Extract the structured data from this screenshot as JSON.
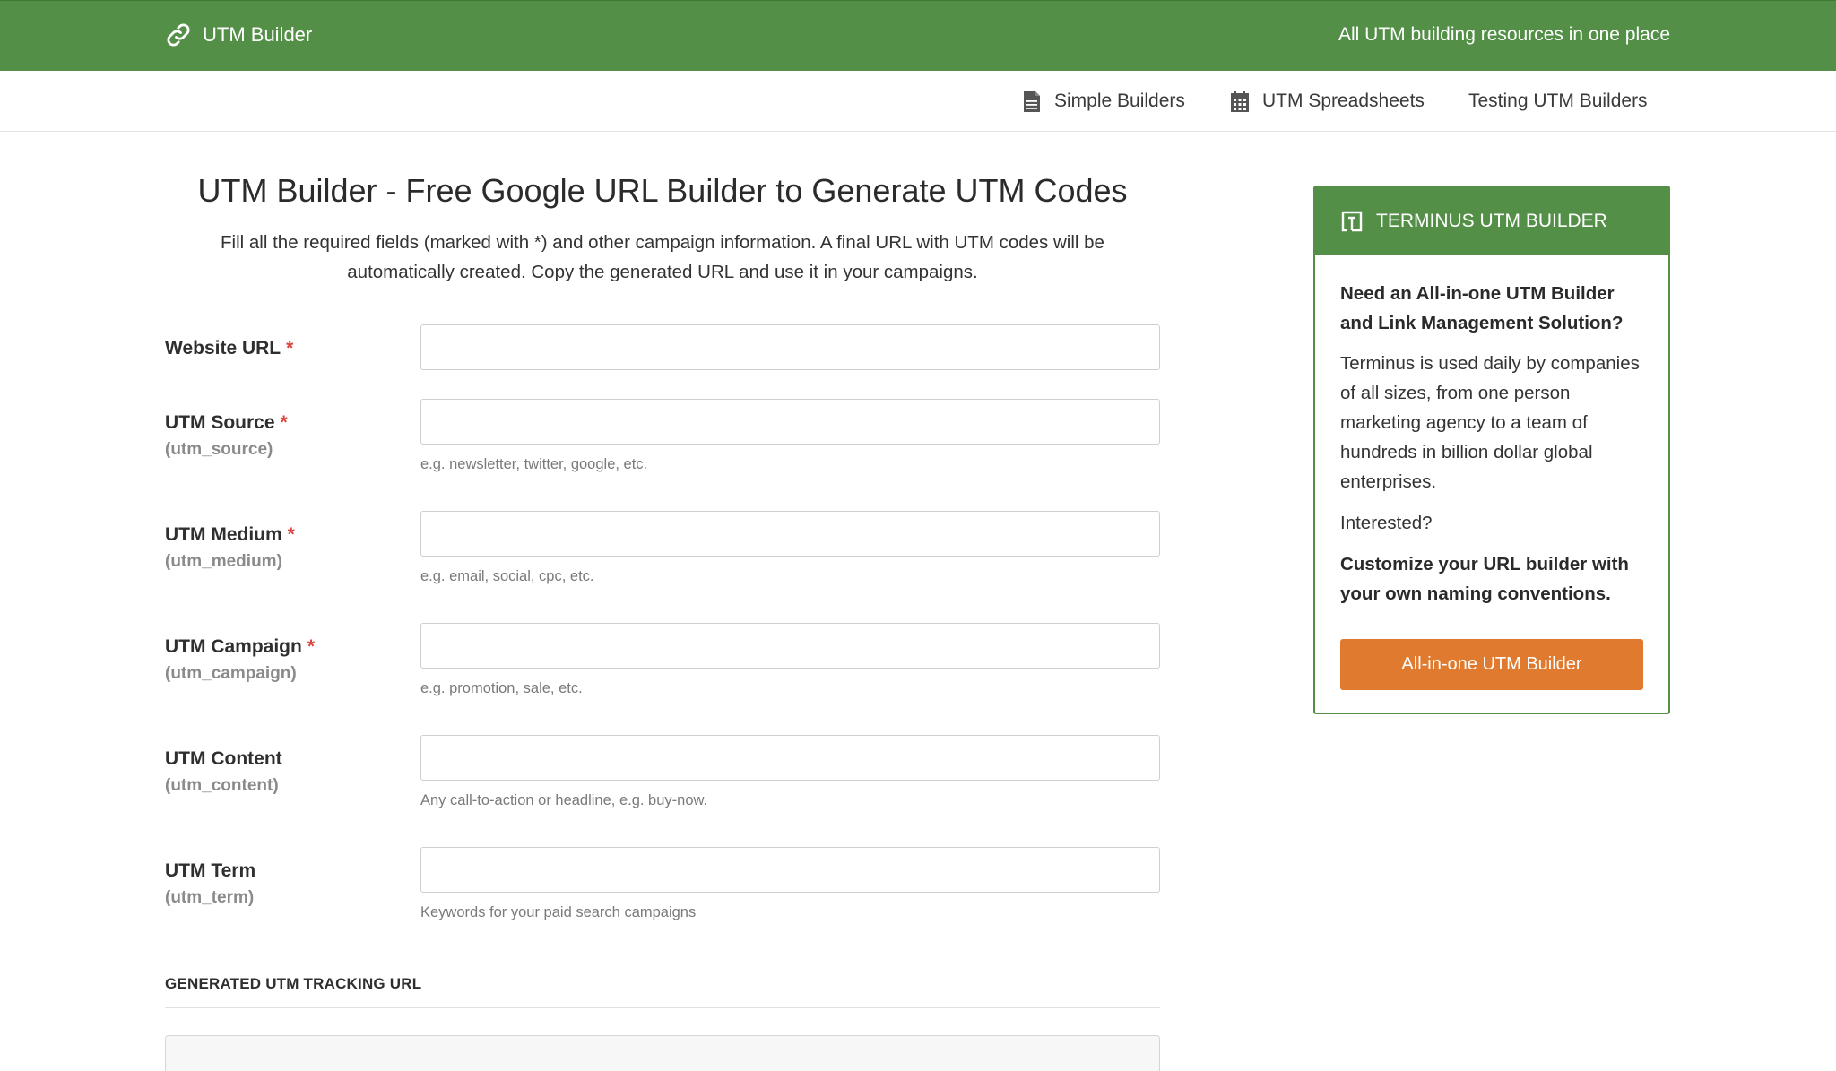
{
  "header": {
    "brand": "UTM Builder",
    "tagline": "All UTM building resources in one place",
    "brand_icon": "link-icon"
  },
  "nav": {
    "items": [
      {
        "label": "Simple Builders",
        "icon": "document-icon"
      },
      {
        "label": "UTM Spreadsheets",
        "icon": "spreadsheet-icon"
      },
      {
        "label": "Testing UTM Builders"
      }
    ]
  },
  "main": {
    "title": "UTM Builder - Free Google URL Builder to Generate UTM Codes",
    "intro": "Fill all the required fields (marked with *) and other campaign information. A final URL with UTM codes will be automatically created. Copy the generated URL and use it in your campaigns.",
    "fields": [
      {
        "label": "Website URL",
        "required": "*",
        "param": "",
        "value": "",
        "help": ""
      },
      {
        "label": "UTM Source",
        "required": "*",
        "param": "(utm_source)",
        "value": "",
        "help": "e.g. newsletter, twitter, google, etc."
      },
      {
        "label": "UTM Medium",
        "required": "*",
        "param": "(utm_medium)",
        "value": "",
        "help": "e.g. email, social, cpc, etc."
      },
      {
        "label": "UTM Campaign",
        "required": "*",
        "param": "(utm_campaign)",
        "value": "",
        "help": "e.g. promotion, sale, etc."
      },
      {
        "label": "UTM Content",
        "required": "",
        "param": "(utm_content)",
        "value": "",
        "help": "Any call-to-action or headline, e.g. buy-now."
      },
      {
        "label": "UTM Term",
        "required": "",
        "param": "(utm_term)",
        "value": "",
        "help": "Keywords for your paid search campaigns"
      }
    ],
    "generated_title": "GENERATED UTM TRACKING URL"
  },
  "sidebar": {
    "title": "TERMINUS UTM BUILDER",
    "icon": "terminus-logo-icon",
    "headline": "Need an All-in-one UTM Builder and Link Management Solution?",
    "body": "Terminus is used daily by companies of all sizes, from one person marketing agency to a team of hundreds in billion dollar global enterprises.",
    "interested": "Interested?",
    "custom": "Customize your URL builder with your own naming conventions.",
    "button": "All-in-one UTM Builder"
  },
  "colors": {
    "brand_green": "#548f48",
    "button_orange": "#e07a2e",
    "required_red": "#d9453d"
  }
}
